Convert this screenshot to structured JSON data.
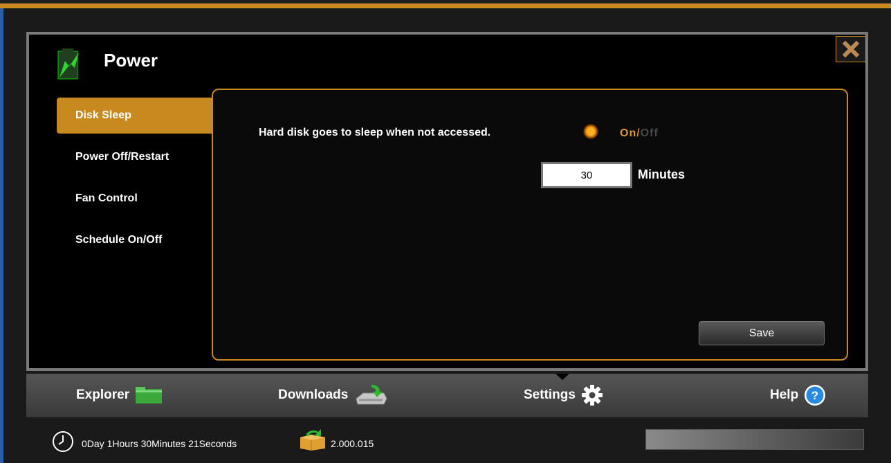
{
  "app": {
    "page_title": "Power"
  },
  "sidebar": {
    "items": [
      {
        "label": "Disk Sleep",
        "active": true
      },
      {
        "label": "Power Off/Restart",
        "active": false
      },
      {
        "label": "Fan Control",
        "active": false
      },
      {
        "label": "Schedule On/Off",
        "active": false
      }
    ]
  },
  "disk_sleep": {
    "description": "Hard disk goes to sleep when not accessed.",
    "on_label": "On",
    "separator": "/",
    "off_label": "Off",
    "state": "On",
    "minutes_value": "30",
    "minutes_label": "Minutes",
    "save_label": "Save"
  },
  "nav": {
    "explorer": "Explorer",
    "downloads": "Downloads",
    "settings": "Settings",
    "help": "Help",
    "active": "Settings"
  },
  "status": {
    "uptime": "0Day 1Hours 30Minutes 21Seconds",
    "firmware": "2.000.015"
  },
  "colors": {
    "accent": "#c8891e",
    "background": "#000000",
    "help_blue": "#2a8ae0"
  },
  "icons": {
    "close": "close-icon",
    "power": "battery-power-icon",
    "explorer": "folder-icon",
    "downloads": "download-drive-icon",
    "settings": "gear-icon",
    "help": "help-icon",
    "clock": "clock-icon",
    "firmware": "firmware-box-icon"
  }
}
